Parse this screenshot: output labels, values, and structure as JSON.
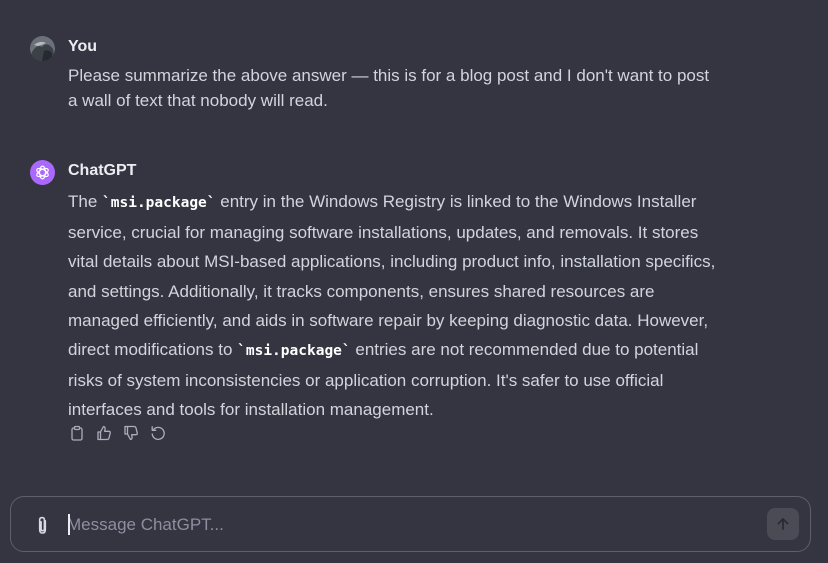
{
  "conversation": {
    "user_message": {
      "author": "You",
      "avatar_icon": "user-avatar",
      "text": "Please summarize the above answer — this is for a blog post and I don't want to post a wall of text that nobody will read."
    },
    "assistant_message": {
      "author": "ChatGPT",
      "avatar_icon": "openai-logo-icon",
      "avatar_color": "#ab68ff",
      "text_1": "The ",
      "code_1": "`msi.package`",
      "text_2": " entry in the Windows Registry is linked to the Windows Installer service, crucial for managing software installations, updates, and removals. It stores vital details about MSI-based applications, including product info, installation specifics, and settings. Additionally, it tracks components, ensures shared resources are managed efficiently, and aids in software repair by keeping diagnostic data. However, direct modifications to ",
      "code_2": "`msi.package`",
      "text_3": " entries are not recommended due to potential risks of system inconsistencies or application corruption. It's safer to use official interfaces and tools for installation management.",
      "actions": [
        "copy-icon",
        "thumbs-up-icon",
        "thumbs-down-icon",
        "regenerate-icon"
      ]
    }
  },
  "composer": {
    "placeholder": "Message ChatGPT...",
    "value": "",
    "attach_icon": "paperclip-icon",
    "send_icon": "arrow-up-icon"
  },
  "colors": {
    "background": "#343541",
    "text": "#ececf1",
    "secondary_text": "#d1d5db",
    "placeholder": "#8e8ea0",
    "send_button": "#4a4b55"
  }
}
